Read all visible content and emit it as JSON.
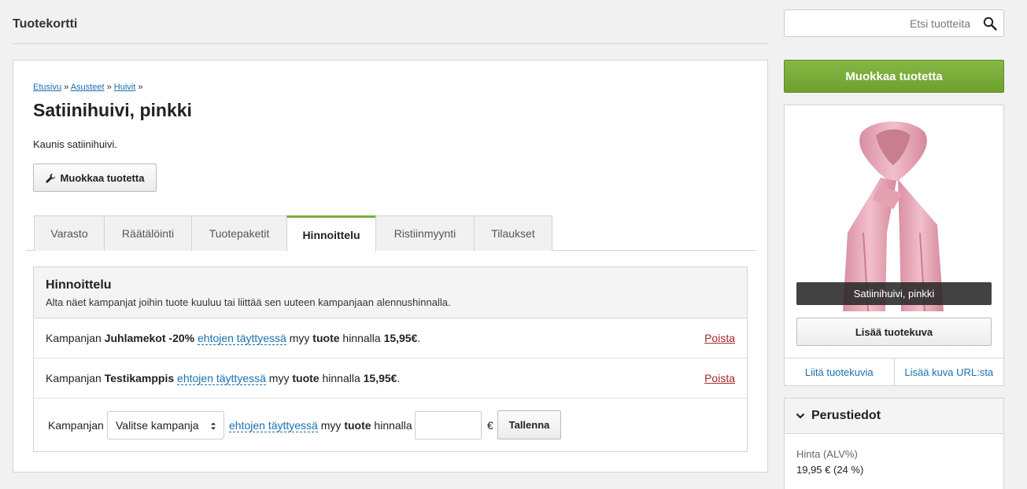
{
  "page_title": "Tuotekortti",
  "search": {
    "placeholder": "Etsi tuotteita"
  },
  "breadcrumb": {
    "items": [
      "Etusivu",
      "Asusteet",
      "Huivit"
    ],
    "separator": "»"
  },
  "product": {
    "title": "Satiinihuivi, pinkki",
    "description": "Kaunis satiinihuivi."
  },
  "edit_button_label": "Muokkaa tuotetta",
  "tabs": [
    {
      "label": "Varasto"
    },
    {
      "label": "Räätälöinti"
    },
    {
      "label": "Tuotepaketit"
    },
    {
      "label": "Hinnoittelu",
      "active": true
    },
    {
      "label": "Ristiinmyynti"
    },
    {
      "label": "Tilaukset"
    }
  ],
  "pricing": {
    "title": "Hinnoittelu",
    "subtitle": "Alta näet kampanjat joihin tuote kuuluu tai liittää sen uuteen kampanjaan alennushinnalla.",
    "text_campaign": "Kampanjan",
    "text_conditions": "ehtojen täyttyessä",
    "text_sells": "myy",
    "text_product": "tuote",
    "text_at_price": "hinnalla",
    "remove_label": "Poista",
    "campaigns": [
      {
        "name": "Juhlamekot -20%",
        "price": "15,95€"
      },
      {
        "name": "Testikamppis",
        "price": "15,95€"
      }
    ],
    "new_campaign": {
      "select_value": "Valitse kampanja",
      "currency": "€",
      "save_label": "Tallenna"
    }
  },
  "sidebar": {
    "edit_button_label": "Muokkaa tuotetta",
    "image_caption": "Satiinihuivi, pinkki",
    "add_image_label": "Lisää tuotekuva",
    "attach_images_label": "Liitä tuotekuvia",
    "add_from_url_label": "Lisää kuva URL:sta",
    "basic_info": {
      "title": "Perustiedot",
      "price_label": "Hinta (ALV%)",
      "price_value": "19,95 € (24 %)"
    }
  },
  "colors": {
    "accent_green": "#7aae3a",
    "link_blue": "#1a6fb0",
    "remove_red": "#a3282b",
    "scarf_pink": "#e9a7b6"
  }
}
